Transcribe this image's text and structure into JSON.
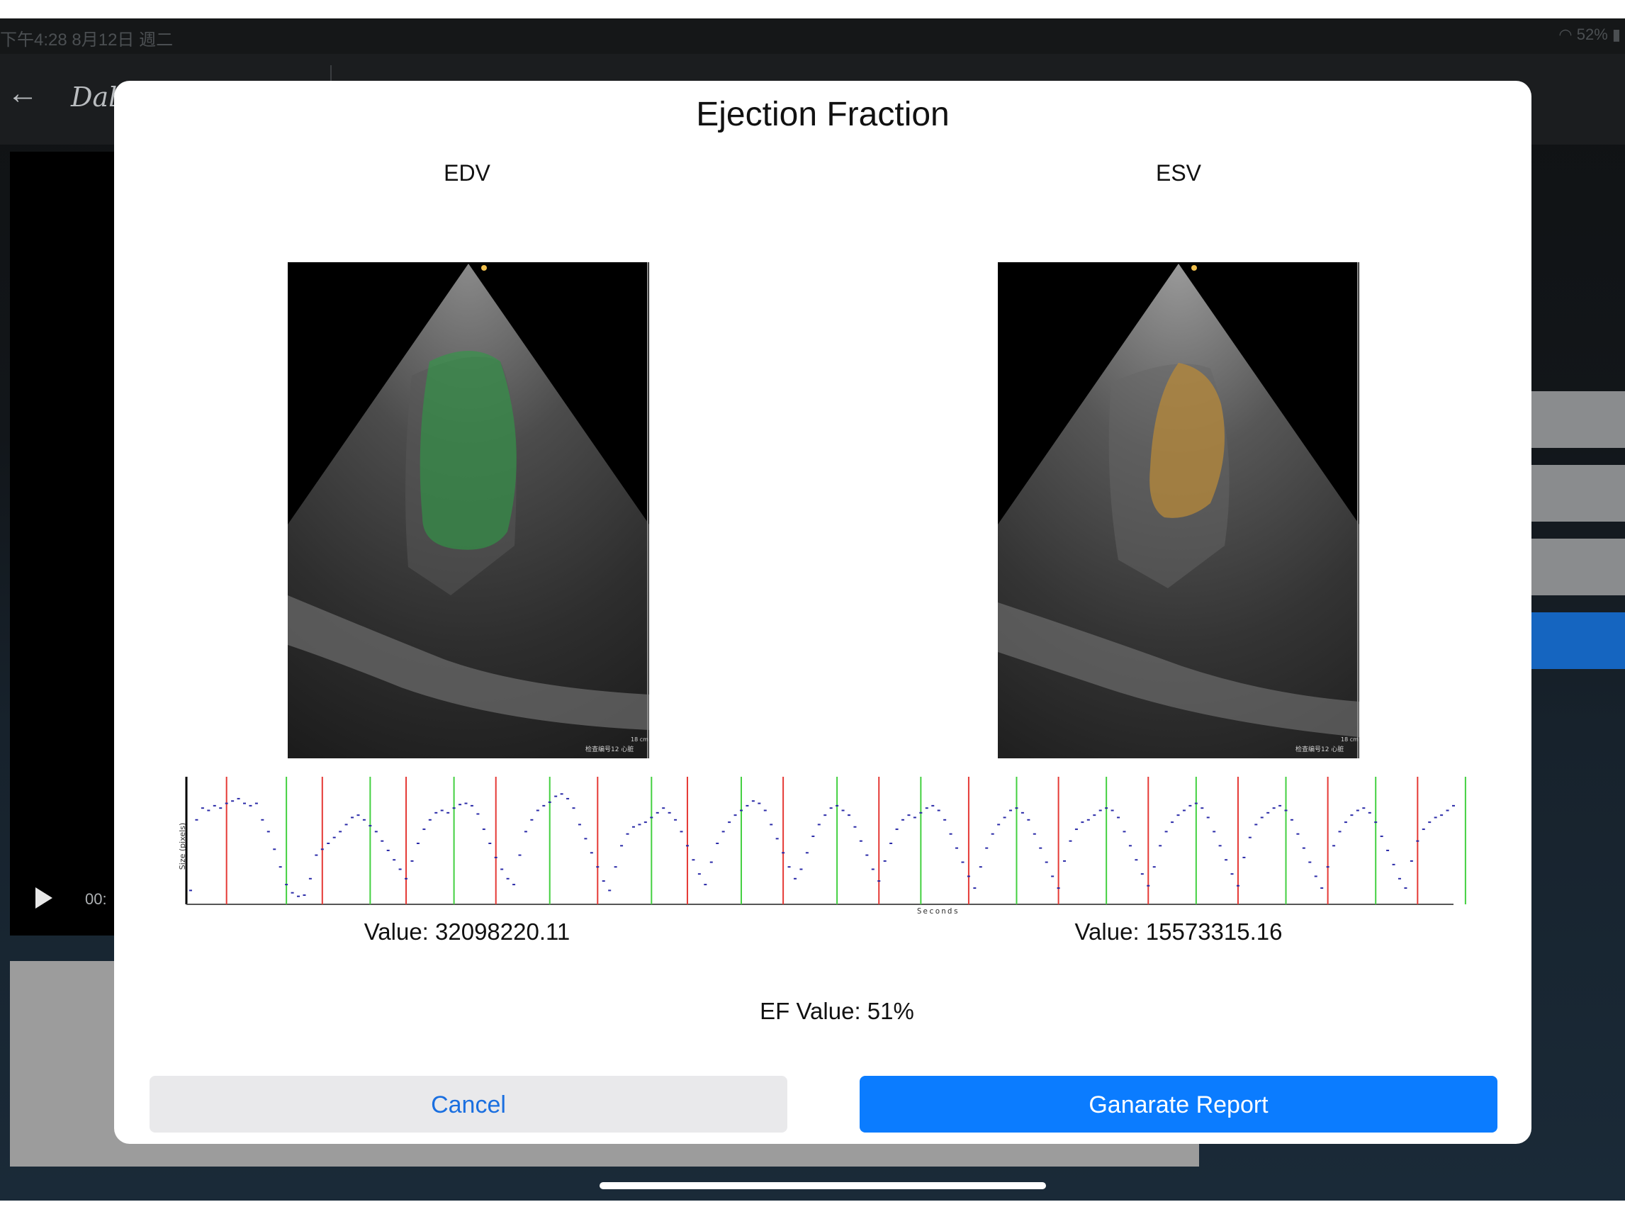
{
  "status_bar": {
    "time_date": "下午4:28  8月12日 週二",
    "battery": "52%"
  },
  "background_app": {
    "logo_text": "Dal",
    "video_time": "00:"
  },
  "modal": {
    "title": "Ejection Fraction",
    "edv_label": "EDV",
    "esv_label": "ESV",
    "edv_value_text": "Value: 32098220.11",
    "esv_value_text": "Value: 15573315.16",
    "ef_value_text": "EF Value: 51%",
    "cancel_label": "Cancel",
    "report_label": "Ganarate Report",
    "echo_caption": "检查编号12  心脏",
    "depth_label": "18 cm"
  },
  "chart_data": {
    "type": "scatter",
    "title": "",
    "xlabel": "Seconds",
    "ylabel": "Size (pixels)",
    "edv_markers_color": "#e53935",
    "esv_markers_color": "#43d040",
    "point_color": "#2a2aa8",
    "edv_marker_frames": [
      6,
      22,
      36,
      51,
      68,
      83,
      99,
      115,
      130,
      145,
      160,
      175,
      190,
      205
    ],
    "esv_marker_frames": [
      16,
      30,
      44,
      60,
      77,
      92,
      108,
      122,
      138,
      153,
      168,
      183,
      198,
      213
    ],
    "series": [
      {
        "values": [
          0.1,
          0.7,
          0.8,
          0.78,
          0.82,
          0.8,
          0.84,
          0.86,
          0.88,
          0.84,
          0.82,
          0.84,
          0.7,
          0.6,
          0.45,
          0.3,
          0.15,
          0.08,
          0.05,
          0.06,
          0.2,
          0.4,
          0.45,
          0.5,
          0.55,
          0.6,
          0.66,
          0.72,
          0.74,
          0.7,
          0.65,
          0.6,
          0.52,
          0.44,
          0.36,
          0.28,
          0.2,
          0.35,
          0.5,
          0.62,
          0.7,
          0.76,
          0.78,
          0.76,
          0.8,
          0.83,
          0.84,
          0.82,
          0.75,
          0.62,
          0.5,
          0.38,
          0.28,
          0.2,
          0.15,
          0.4,
          0.6,
          0.7,
          0.78,
          0.82,
          0.85,
          0.9,
          0.92,
          0.88,
          0.8,
          0.66,
          0.54,
          0.42,
          0.3,
          0.18,
          0.1,
          0.3,
          0.48,
          0.58,
          0.64,
          0.66,
          0.68,
          0.72,
          0.76,
          0.8,
          0.76,
          0.7,
          0.6,
          0.48,
          0.36,
          0.24,
          0.15,
          0.34,
          0.5,
          0.6,
          0.68,
          0.74,
          0.78,
          0.82,
          0.86,
          0.84,
          0.78,
          0.66,
          0.54,
          0.42,
          0.3,
          0.2,
          0.28,
          0.42,
          0.56,
          0.66,
          0.74,
          0.8,
          0.82,
          0.78,
          0.74,
          0.64,
          0.52,
          0.4,
          0.28,
          0.18,
          0.35,
          0.5,
          0.62,
          0.7,
          0.74,
          0.72,
          0.76,
          0.8,
          0.82,
          0.78,
          0.7,
          0.58,
          0.46,
          0.34,
          0.22,
          0.12,
          0.3,
          0.46,
          0.58,
          0.66,
          0.72,
          0.78,
          0.8,
          0.76,
          0.7,
          0.58,
          0.46,
          0.34,
          0.22,
          0.12,
          0.35,
          0.52,
          0.62,
          0.68,
          0.7,
          0.74,
          0.78,
          0.8,
          0.78,
          0.72,
          0.6,
          0.48,
          0.36,
          0.24,
          0.14,
          0.3,
          0.48,
          0.6,
          0.68,
          0.74,
          0.78,
          0.82,
          0.84,
          0.8,
          0.72,
          0.6,
          0.48,
          0.36,
          0.24,
          0.14,
          0.38,
          0.55,
          0.66,
          0.72,
          0.76,
          0.8,
          0.82,
          0.78,
          0.7,
          0.58,
          0.46,
          0.34,
          0.22,
          0.12,
          0.3,
          0.48,
          0.6,
          0.68,
          0.74,
          0.78,
          0.8,
          0.76,
          0.68,
          0.56,
          0.44,
          0.32,
          0.2,
          0.12,
          0.35,
          0.52,
          0.62,
          0.68,
          0.72,
          0.74,
          0.78,
          0.82
        ]
      }
    ]
  }
}
